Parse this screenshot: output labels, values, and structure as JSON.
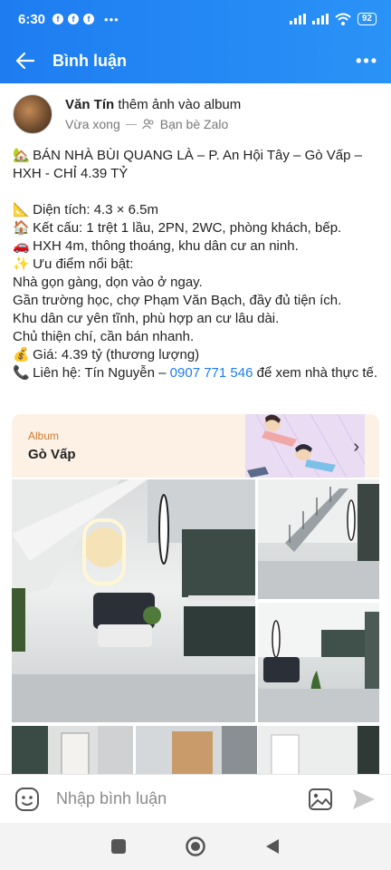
{
  "status": {
    "time": "6:30",
    "battery": "92"
  },
  "header": {
    "title": "Bình luận"
  },
  "author": {
    "name": "Văn Tín",
    "action": " thêm ảnh vào album",
    "time": "Vừa xong",
    "audience": "Bạn bè Zalo"
  },
  "post": {
    "title": "BÁN NHÀ BÙI QUANG LÀ – P. An Hội Tây – Gò Vấp – HXH - CHỈ 4.39 TỶ",
    "area": "Diện tích: 4.3 × 6.5m",
    "structure": "Kết cấu: 1 trệt 1 lầu, 2PN, 2WC, phòng khách, bếp.",
    "road": "HXH 4m, thông thoáng, khu dân cư an ninh.",
    "pros_title": "Ưu điểm nổi bật:",
    "pro1": "Nhà gọn gàng, dọn vào ở ngay.",
    "pro2": "Gần trường học, chợ Phạm Văn Bạch, đầy đủ tiện ích.",
    "pro3": "Khu dân cư yên tĩnh, phù hợp an cư lâu dài.",
    "pro4": "Chủ thiện chí, cần bán nhanh.",
    "price": "Giá: 4.39 tỷ (thương lượng)",
    "contact_prefix": "Liên hệ: Tín Nguyễn – ",
    "phone": "0907 771 546",
    "contact_suffix": " để xem nhà thực tế."
  },
  "album": {
    "label": "Album",
    "name": "Gò Vấp"
  },
  "comment": {
    "placeholder": "Nhập bình luận"
  }
}
